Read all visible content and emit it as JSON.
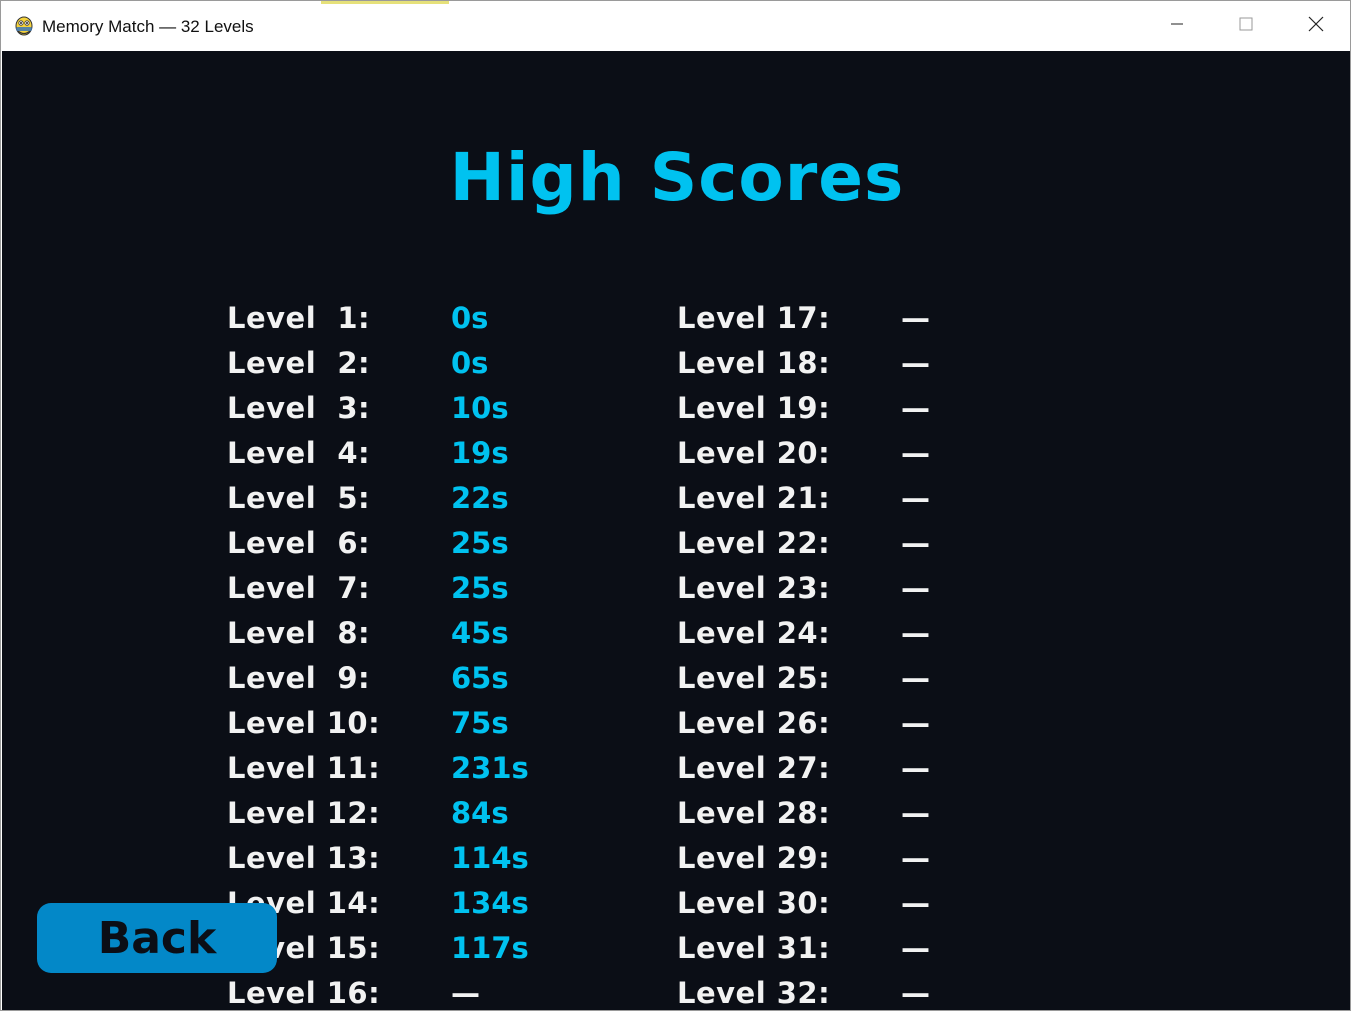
{
  "window": {
    "title": "Memory Match — 32 Levels",
    "icon": "pygame-snake-icon"
  },
  "colors": {
    "background": "#0b0e16",
    "accent": "#00c2f0",
    "label": "#f2f2f2",
    "button": "#0388c8"
  },
  "screen": {
    "heading": "High Scores",
    "back_label": "Back"
  },
  "scores_left": [
    {
      "label": "Level  1:",
      "score": "0s"
    },
    {
      "label": "Level  2:",
      "score": "0s"
    },
    {
      "label": "Level  3:",
      "score": "10s"
    },
    {
      "label": "Level  4:",
      "score": "19s"
    },
    {
      "label": "Level  5:",
      "score": "22s"
    },
    {
      "label": "Level  6:",
      "score": "25s"
    },
    {
      "label": "Level  7:",
      "score": "25s"
    },
    {
      "label": "Level  8:",
      "score": "45s"
    },
    {
      "label": "Level  9:",
      "score": "65s"
    },
    {
      "label": "Level 10:",
      "score": "75s"
    },
    {
      "label": "Level 11:",
      "score": "231s"
    },
    {
      "label": "Level 12:",
      "score": "84s"
    },
    {
      "label": "Level 13:",
      "score": "114s"
    },
    {
      "label": "Level 14:",
      "score": "134s"
    },
    {
      "label": "Level 15:",
      "score": "117s"
    },
    {
      "label": "Level 16:",
      "score": "—"
    }
  ],
  "scores_right": [
    {
      "label": "Level 17:",
      "score": "—"
    },
    {
      "label": "Level 18:",
      "score": "—"
    },
    {
      "label": "Level 19:",
      "score": "—"
    },
    {
      "label": "Level 20:",
      "score": "—"
    },
    {
      "label": "Level 21:",
      "score": "—"
    },
    {
      "label": "Level 22:",
      "score": "—"
    },
    {
      "label": "Level 23:",
      "score": "—"
    },
    {
      "label": "Level 24:",
      "score": "—"
    },
    {
      "label": "Level 25:",
      "score": "—"
    },
    {
      "label": "Level 26:",
      "score": "—"
    },
    {
      "label": "Level 27:",
      "score": "—"
    },
    {
      "label": "Level 28:",
      "score": "—"
    },
    {
      "label": "Level 29:",
      "score": "—"
    },
    {
      "label": "Level 30:",
      "score": "—"
    },
    {
      "label": "Level 31:",
      "score": "—"
    },
    {
      "label": "Level 32:",
      "score": "—"
    }
  ]
}
